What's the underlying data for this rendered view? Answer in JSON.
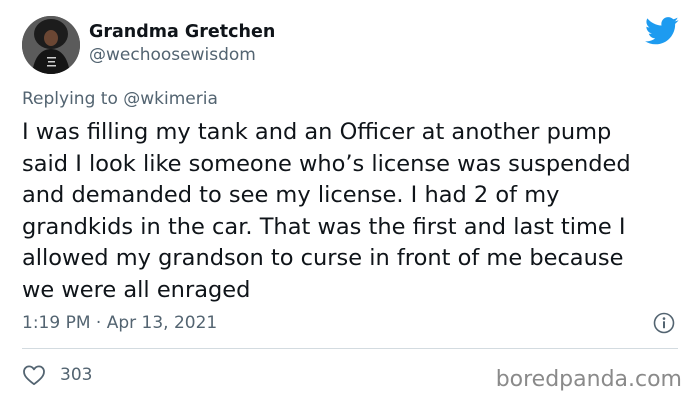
{
  "author": {
    "display_name": "Grandma Gretchen",
    "handle": "@wechoosewisdom",
    "avatar_icon": "profile-photo"
  },
  "reply": {
    "prefix": "Replying to ",
    "mention": "@wkimeria"
  },
  "tweet": {
    "lines": [
      "I was filling my tank and an Officer at another pump",
      "said I look like someone who’s license was suspended",
      "and demanded to see my license. I had 2 of my",
      "grandkids in the car. That was the first and last time I",
      "allowed my grandson to curse in front of me because",
      "we were all enraged"
    ],
    "timestamp": "1:19 PM · Apr 13, 2021"
  },
  "engagement": {
    "like_count": "303",
    "like_icon": "heart-icon",
    "info_icon": "info-icon"
  },
  "platform_icon": "twitter-bird-icon",
  "watermark": "boredpanda.com",
  "colors": {
    "brand_blue": "#1d9bf0",
    "text_primary": "#0f1419",
    "text_secondary": "#536471",
    "divider": "#d3dbe0",
    "watermark": "#8a8a8a"
  }
}
